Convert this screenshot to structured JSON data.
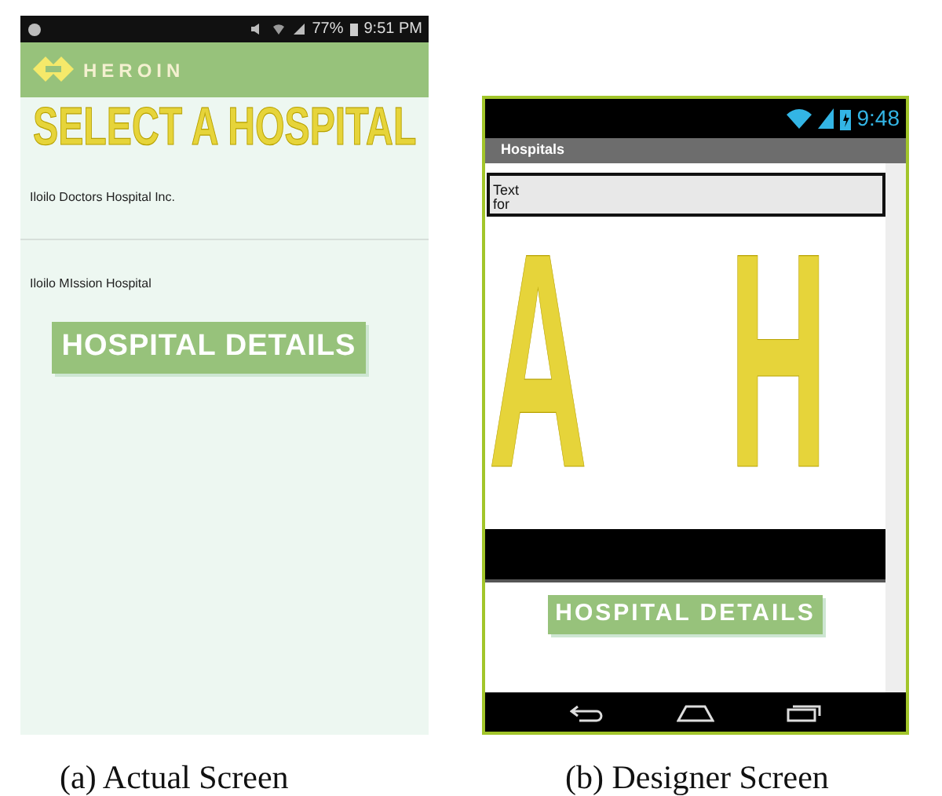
{
  "actual_screen": {
    "status_bar": {
      "battery": "77%",
      "time": "9:51 PM"
    },
    "app_bar": {
      "logo_text": "HEROIN"
    },
    "title": "SELECT A HOSPITAL",
    "hospitals": [
      {
        "name": "Iloilo Doctors Hospital Inc."
      },
      {
        "name": "Iloilo MIssion Hospital"
      }
    ],
    "button": "HOSPITAL DETAILS",
    "caption": "(a) Actual Screen"
  },
  "designer_screen": {
    "status_bar": {
      "time": "9:48"
    },
    "title_bar": "Hospitals",
    "text_box": [
      "Text",
      "for"
    ],
    "large_letters": [
      "A",
      "H"
    ],
    "button": "HOSPITAL DETAILS",
    "caption": "(b) Designer Screen"
  }
}
